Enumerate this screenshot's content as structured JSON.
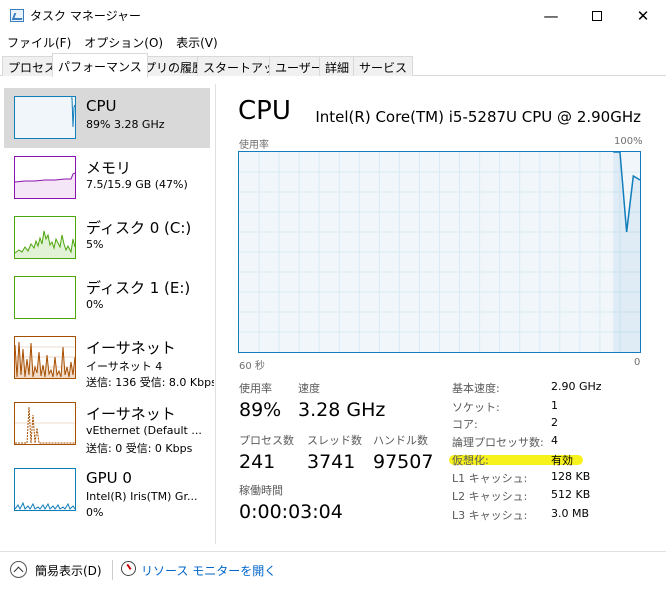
{
  "window": {
    "title": "タスク マネージャー",
    "minimize": "—",
    "close": "✕"
  },
  "menu": [
    "ファイル(F)",
    "オプション(O)",
    "表示(V)"
  ],
  "tabs": [
    "プロセス",
    "パフォーマンス",
    "アプリの履歴",
    "スタートアップ",
    "ユーザー",
    "詳細",
    "サービス"
  ],
  "active_tab": 1,
  "sidebar": [
    {
      "title": "CPU",
      "line1": "89%  3.28 GHz",
      "line2": "",
      "color": "#117dbb"
    },
    {
      "title": "メモリ",
      "line1": "7.5/15.9 GB (47%)",
      "line2": "",
      "color": "#8b12ae"
    },
    {
      "title": "ディスク 0 (C:)",
      "line1": "5%",
      "line2": "",
      "color": "#4da60c"
    },
    {
      "title": "ディスク 1 (E:)",
      "line1": "0%",
      "line2": "",
      "color": "#4da60c"
    },
    {
      "title": "イーサネット",
      "line1": "イーサネット 4",
      "line2": "送信: 136  受信: 8.0 Kbps",
      "color": "#a74f01"
    },
    {
      "title": "イーサネット",
      "line1": "vEthernet (Default ...",
      "line2": "送信: 0  受信: 0 Kbps",
      "color": "#a74f01"
    },
    {
      "title": "GPU 0",
      "line1": "Intel(R) Iris(TM) Gr...",
      "line2": "0%",
      "color": "#117dbb"
    }
  ],
  "cpu": {
    "heading": "CPU",
    "model": "Intel(R) Core(TM) i5-5287U CPU @ 2.90GHz",
    "graph_label": "使用率",
    "graph_max": "100%",
    "graph_time": "60 秒",
    "graph_min": "0",
    "usage_series": [
      100,
      100,
      60,
      88,
      86
    ],
    "stats": {
      "usage_label": "使用率",
      "usage_value": "89%",
      "speed_label": "速度",
      "speed_value": "3.28 GHz",
      "processes_label": "プロセス数",
      "processes_value": "241",
      "threads_label": "スレッド数",
      "threads_value": "3741",
      "handles_label": "ハンドル数",
      "handles_value": "97507",
      "uptime_label": "稼働時間",
      "uptime_value": "0:00:03:04"
    },
    "specs": [
      {
        "label": "基本速度:",
        "value": "2.90 GHz"
      },
      {
        "label": "ソケット:",
        "value": "1"
      },
      {
        "label": "コア:",
        "value": "2"
      },
      {
        "label": "論理プロセッサ数:",
        "value": "4"
      },
      {
        "label": "仮想化:",
        "value": "有効"
      },
      {
        "label": "L1 キャッシュ:",
        "value": "128 KB"
      },
      {
        "label": "L2 キャッシュ:",
        "value": "512 KB"
      },
      {
        "label": "L3 キャッシュ:",
        "value": "3.0 MB"
      }
    ],
    "highlight_color": "#f7f21b"
  },
  "footer": {
    "simple_view": "簡易表示(D)",
    "resource_monitor": "リソース モニターを開く"
  }
}
